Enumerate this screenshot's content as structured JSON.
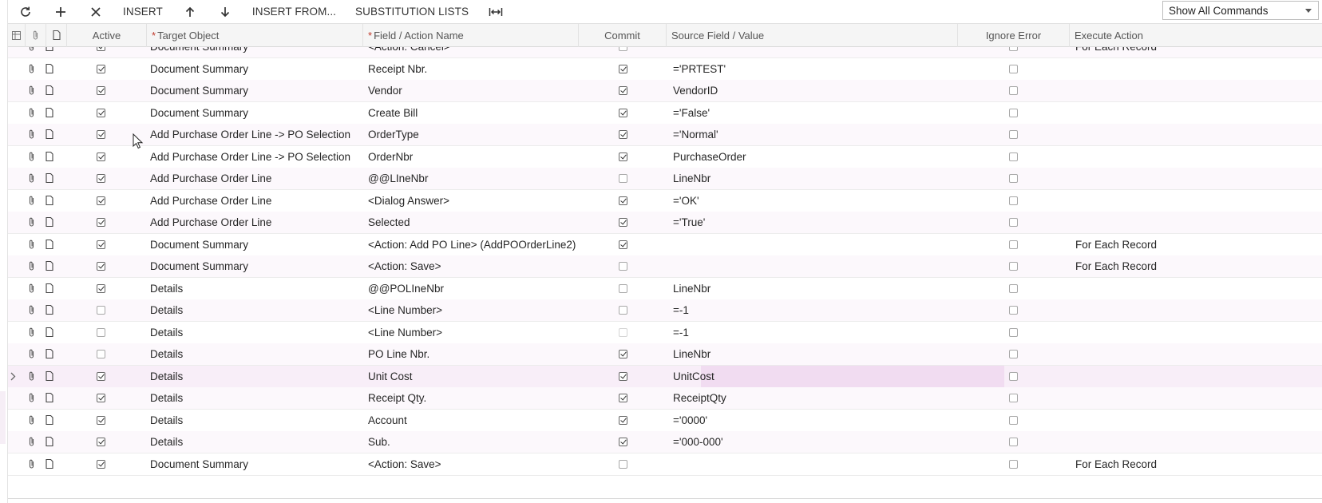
{
  "toolbar": {
    "refresh_icon": "refresh-icon",
    "add_icon": "plus-icon",
    "delete_icon": "close-icon",
    "insert_label": "INSERT",
    "move_up_icon": "arrow-up-icon",
    "move_down_icon": "arrow-down-icon",
    "insert_from_label": "INSERT FROM...",
    "substitution_lists_label": "SUBSTITUTION LISTS",
    "fit_columns_icon": "fit-width-icon",
    "commands_select_value": "Show All Commands"
  },
  "grid": {
    "columns": {
      "active": "Active",
      "target_object": "Target Object",
      "field_action": "Field / Action Name",
      "commit": "Commit",
      "source_value": "Source Field / Value",
      "ignore_error": "Ignore Error",
      "execute_action": "Execute Action"
    },
    "required_marker": "*",
    "rows": [
      {
        "active": true,
        "target": "Document Summary",
        "field": "<Action: Cancel>",
        "commit": false,
        "commit_style": "muted",
        "source": "",
        "ignore_error": false,
        "execute": "For Each Record"
      },
      {
        "active": true,
        "target": "Document Summary",
        "field": "Receipt Nbr.",
        "commit": true,
        "commit_style": "normal",
        "source": "='PRTEST'",
        "ignore_error": false,
        "execute": ""
      },
      {
        "active": true,
        "target": "Document Summary",
        "field": "Vendor",
        "commit": true,
        "commit_style": "normal",
        "source": "VendorID",
        "ignore_error": false,
        "execute": ""
      },
      {
        "active": true,
        "target": "Document Summary",
        "field": "Create Bill",
        "commit": true,
        "commit_style": "normal",
        "source": "='False'",
        "ignore_error": false,
        "execute": ""
      },
      {
        "active": true,
        "target": "Add Purchase Order Line -> PO Selection",
        "field": "OrderType",
        "commit": true,
        "commit_style": "normal",
        "source": "='Normal'",
        "ignore_error": false,
        "execute": ""
      },
      {
        "active": true,
        "target": "Add Purchase Order Line -> PO Selection",
        "field": "OrderNbr",
        "commit": true,
        "commit_style": "normal",
        "source": "PurchaseOrder",
        "ignore_error": false,
        "execute": ""
      },
      {
        "active": true,
        "target": "Add Purchase Order Line",
        "field": "@@LIneNbr",
        "commit": false,
        "commit_style": "muted",
        "source": "LineNbr",
        "ignore_error": false,
        "execute": ""
      },
      {
        "active": true,
        "target": "Add Purchase Order Line",
        "field": "<Dialog Answer>",
        "commit": true,
        "commit_style": "normal",
        "source": "='OK'",
        "ignore_error": false,
        "execute": ""
      },
      {
        "active": true,
        "target": "Add Purchase Order Line",
        "field": "Selected",
        "commit": true,
        "commit_style": "normal",
        "source": "='True'",
        "ignore_error": false,
        "execute": ""
      },
      {
        "active": true,
        "target": "Document Summary",
        "field": "<Action: Add PO Line> (AddPOOrderLine2)",
        "commit": true,
        "commit_style": "normal",
        "source": "",
        "ignore_error": false,
        "execute": "For Each Record"
      },
      {
        "active": true,
        "target": "Document Summary",
        "field": "<Action: Save>",
        "commit": false,
        "commit_style": "muted",
        "source": "",
        "ignore_error": false,
        "execute": "For Each Record"
      },
      {
        "active": true,
        "target": "Details",
        "field": "@@POLIneNbr",
        "commit": false,
        "commit_style": "muted",
        "source": "LineNbr",
        "ignore_error": false,
        "execute": ""
      },
      {
        "active": false,
        "target": "Details",
        "field": "<Line Number>",
        "commit": false,
        "commit_style": "muted",
        "source": "=-1",
        "ignore_error": false,
        "execute": ""
      },
      {
        "active": false,
        "target": "Details",
        "field": "<Line Number>",
        "commit": false,
        "commit_style": "faint",
        "source": "=-1",
        "ignore_error": false,
        "execute": ""
      },
      {
        "active": false,
        "target": "Details",
        "field": "PO Line Nbr.",
        "commit": true,
        "commit_style": "normal",
        "source": "LineNbr",
        "ignore_error": false,
        "execute": ""
      },
      {
        "active": true,
        "target": "Details",
        "field": "Unit Cost",
        "commit": true,
        "commit_style": "normal",
        "source": "UnitCost",
        "ignore_error": false,
        "execute": "",
        "selected": true
      },
      {
        "active": true,
        "target": "Details",
        "field": "Receipt Qty.",
        "commit": true,
        "commit_style": "normal",
        "source": "ReceiptQty",
        "ignore_error": false,
        "execute": ""
      },
      {
        "active": true,
        "target": "Details",
        "field": "Account",
        "commit": true,
        "commit_style": "normal",
        "source": "='0000'",
        "ignore_error": false,
        "execute": ""
      },
      {
        "active": true,
        "target": "Details",
        "field": "Sub.",
        "commit": true,
        "commit_style": "normal",
        "source": "='000-000'",
        "ignore_error": false,
        "execute": ""
      },
      {
        "active": true,
        "target": "Document Summary",
        "field": "<Action: Save>",
        "commit": false,
        "commit_style": "muted",
        "source": "",
        "ignore_error": false,
        "execute": "For Each Record"
      }
    ]
  }
}
